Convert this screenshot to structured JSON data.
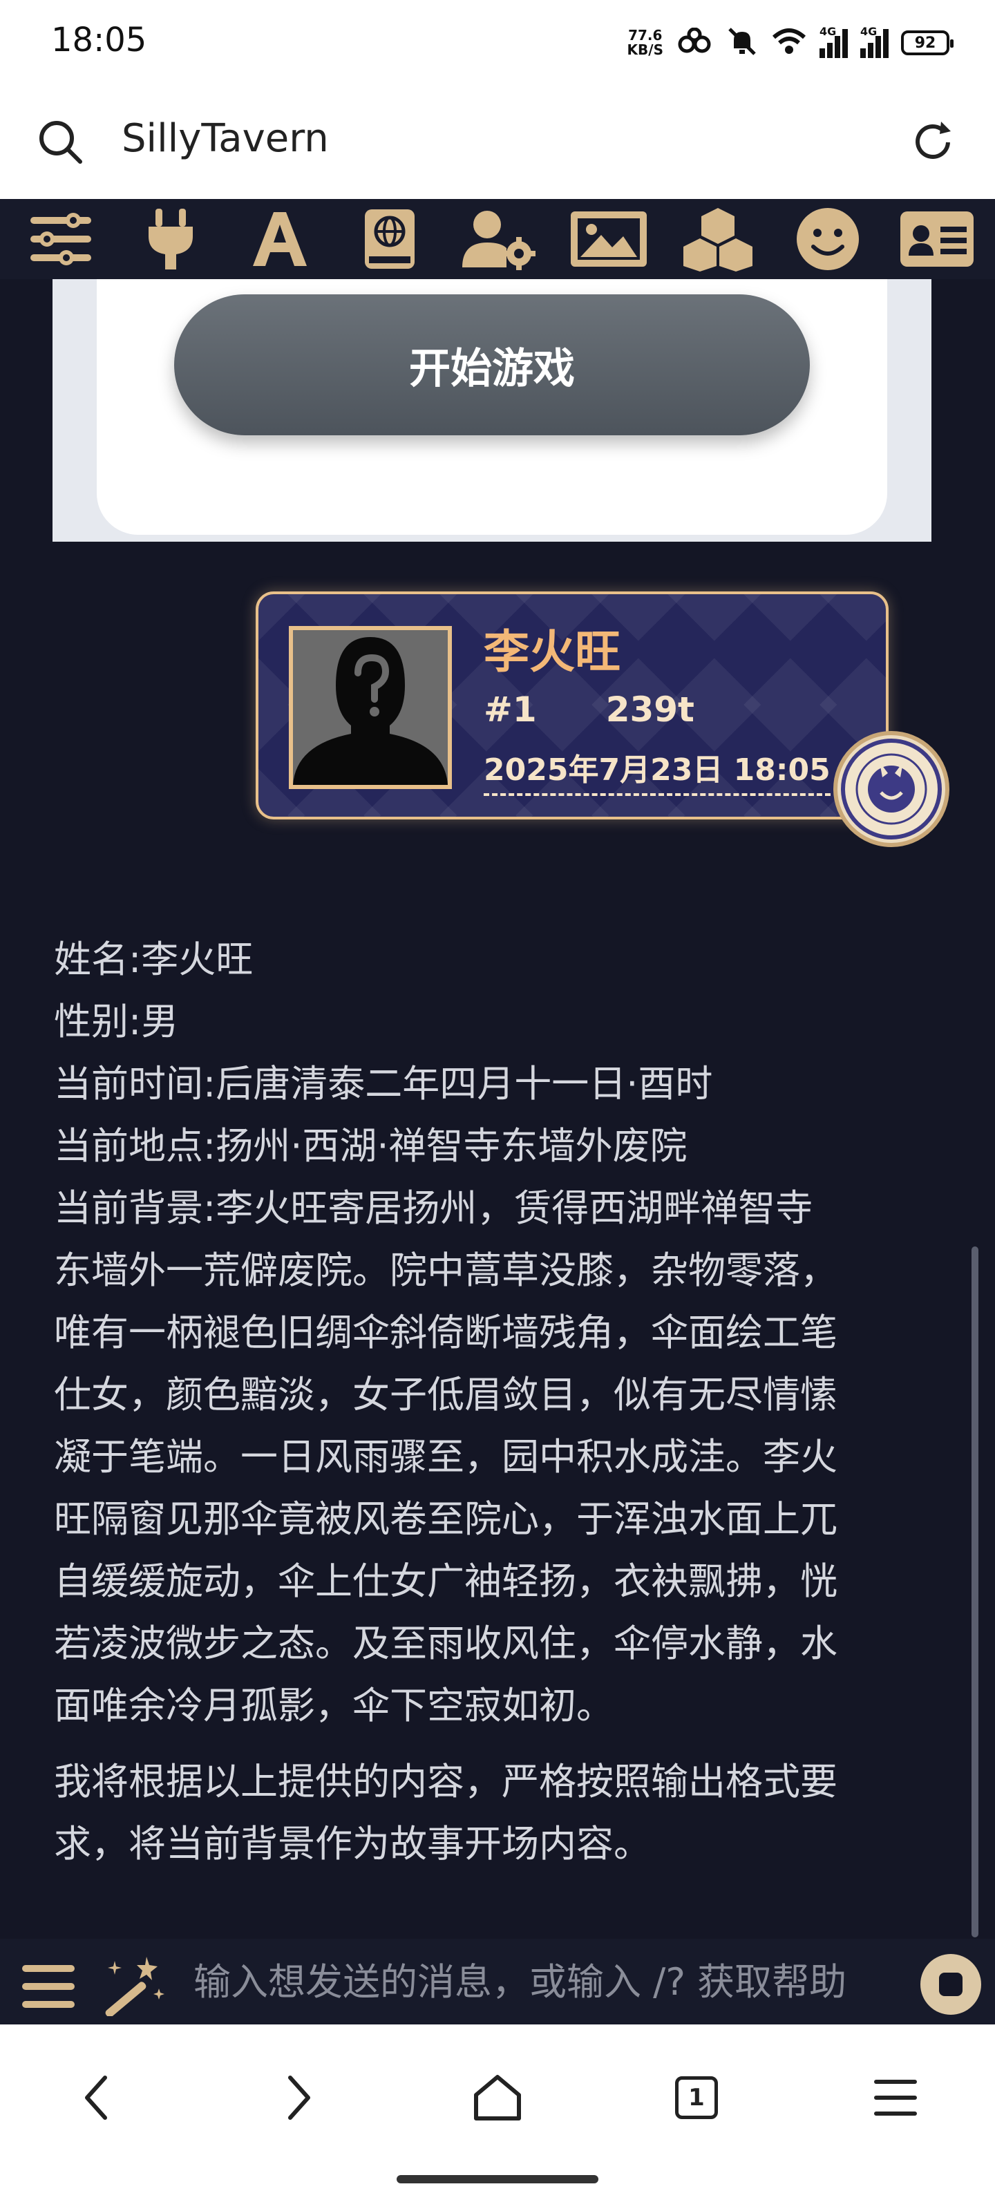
{
  "status_bar": {
    "time": "18:05",
    "net_speed_value": "77.6",
    "net_speed_unit": "KB/S",
    "signal_1_label": "4G",
    "signal_2_label": "4G",
    "battery": "92"
  },
  "browser": {
    "url_text": "SillyTavern"
  },
  "toolbar": {
    "icons": [
      "sliders-icon",
      "plug-icon",
      "text-font-icon",
      "book-globe-icon",
      "user-gear-icon",
      "image-icon",
      "cubes-icon",
      "smiley-icon",
      "id-card-icon"
    ]
  },
  "chat": {
    "start_button": "开始游戏",
    "card": {
      "name": "李火旺",
      "message_id": "#1",
      "tokens": "239t",
      "date": "2025年7月23日 18:05"
    },
    "message": {
      "lines": [
        "姓名:李火旺",
        "性别:男",
        "当前时间:后唐清泰二年四月十一日·酉时",
        "当前地点:扬州·西湖·禅智寺东墙外废院",
        "当前背景:李火旺寄居扬州，赁得西湖畔禅智寺",
        "东墙外一荒僻废院。院中蒿草没膝，杂物零落，",
        "唯有一柄褪色旧绸伞斜倚断墙残角，伞面绘工笔",
        "仕女，颜色黯淡，女子低眉敛目，似有无尽情愫",
        "凝于笔端。一日风雨骤至，园中积水成洼。李火",
        "旺隔窗见那伞竟被风卷至院心，于浑浊水面上兀",
        "自缓缓旋动，伞上仕女广袖轻扬，衣袂飘拂，恍",
        "若凌波微步之态。及至雨收风住，伞停水静，水",
        "面唯余冷月孤影，伞下空寂如初。"
      ],
      "closing_lines": [
        "我将根据以上提供的内容，严格按照输出格式要",
        "求，将当前背景作为故事开场内容。"
      ]
    }
  },
  "input": {
    "placeholder": "输入想发送的消息，或输入 /? 获取帮助"
  },
  "nav": {
    "tab_count": "1"
  },
  "colors": {
    "accent": "#e8c08a",
    "name_color": "#f3b877",
    "chat_bg": "#141625",
    "toolbar_bg": "#171a2a"
  }
}
